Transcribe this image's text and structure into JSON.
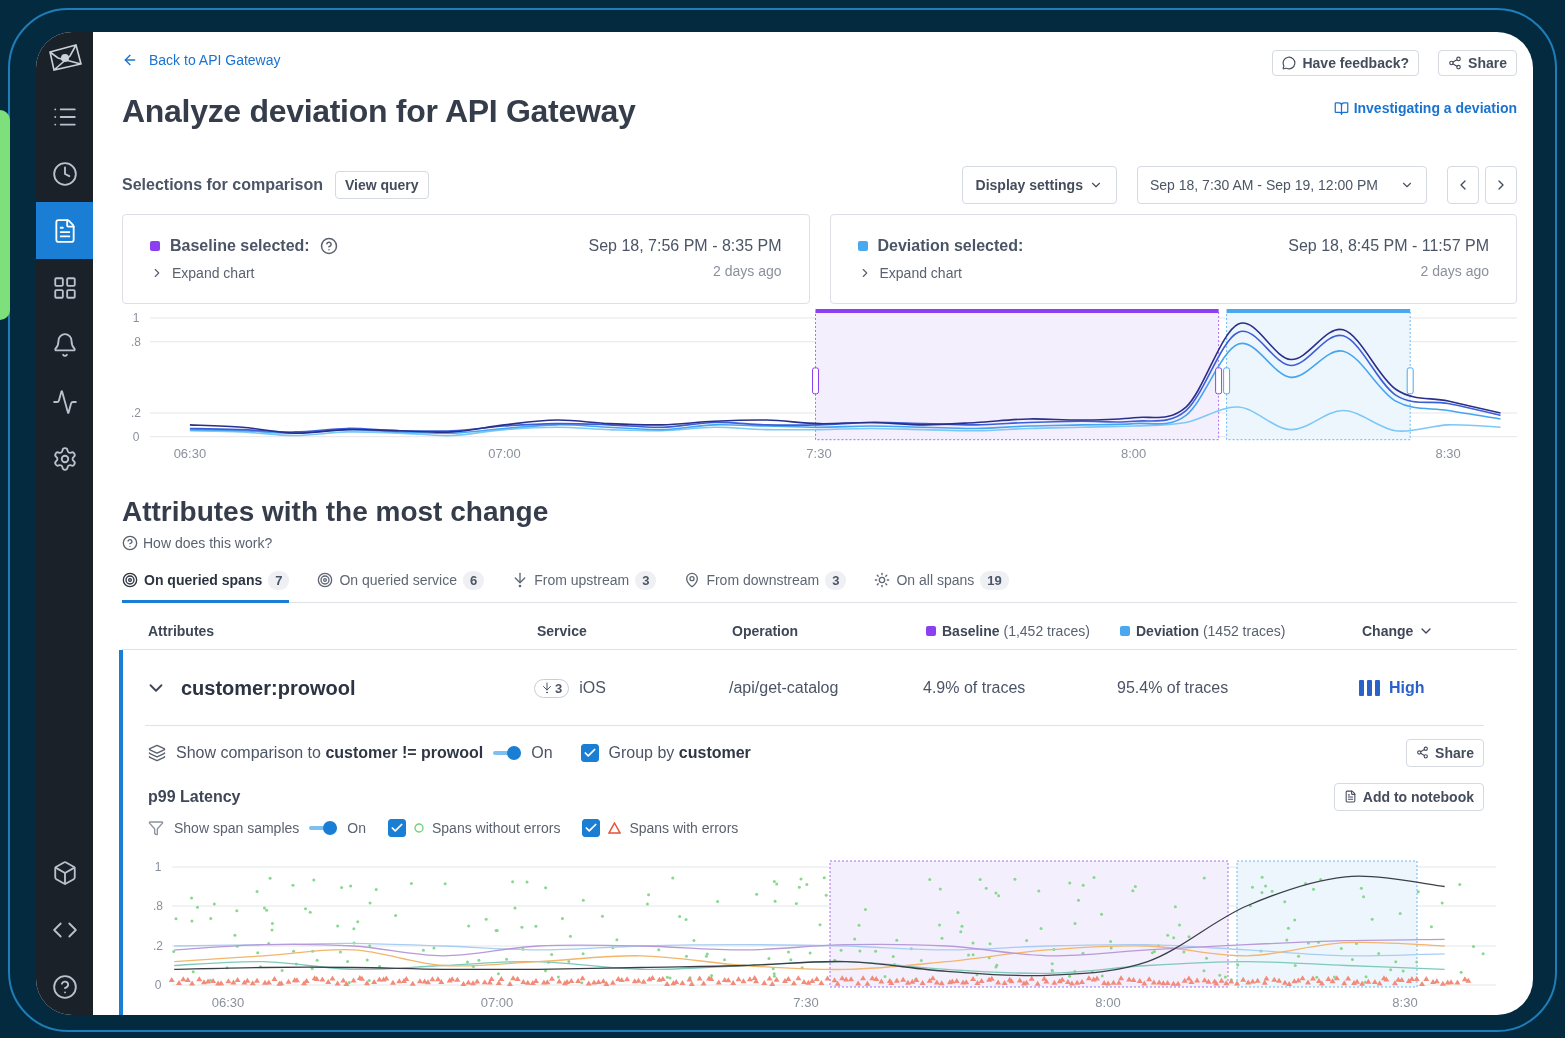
{
  "sidebar": {
    "nav": [
      {
        "selected": false
      },
      {
        "selected": false
      },
      {
        "selected": true
      },
      {
        "selected": false
      },
      {
        "selected": false
      },
      {
        "selected": false
      },
      {
        "selected": false
      }
    ],
    "footer": [
      {
        "selected": false
      },
      {
        "selected": false
      },
      {
        "selected": false
      }
    ]
  },
  "header": {
    "back_link": "Back to API Gateway",
    "title": "Analyze deviation for API Gateway",
    "feedback": "Have feedback?",
    "share": "Share",
    "guide_link": "Investigating a deviation"
  },
  "selections": {
    "label": "Selections for comparison",
    "view_query": "View query",
    "display_settings": "Display settings",
    "range": "Sep 18, 7:30 AM - Sep 19, 12:00 PM"
  },
  "cards": [
    {
      "title": "Baseline selected:",
      "color": "#8b3ff0",
      "help": true,
      "expand": "Expand chart",
      "range": "Sep 18, 7:56 PM - 8:35 PM",
      "ago": "2 days ago"
    },
    {
      "title": "Deviation selected:",
      "color": "#4aa8f0",
      "help": false,
      "expand": "Expand chart",
      "range": "Sep 18, 8:45 PM - 11:57 PM",
      "ago": "2 days ago"
    }
  ],
  "overview_chart": {
    "chart_data": {
      "type": "line",
      "categories": [
        "06:30",
        null,
        null,
        null,
        null,
        null,
        "07:00",
        null,
        null,
        null,
        null,
        null,
        "7:30",
        null,
        null,
        null,
        null,
        null,
        "8:00",
        null,
        null,
        null,
        null,
        null,
        "8:30",
        null
      ],
      "ylim": [
        0,
        1
      ],
      "yticks": [
        {
          "value": 1,
          "label": "1"
        },
        {
          "value": 0.8,
          "label": ".8"
        },
        {
          "value": 0.2,
          "label": ".2"
        },
        {
          "value": 0,
          "label": "0"
        }
      ],
      "series": [
        {
          "color": "#7cc8f7",
          "values": [
            0.05,
            0.04,
            0.01,
            0.04,
            0.03,
            0.01,
            0.06,
            0.08,
            0.06,
            0.05,
            0.08,
            0.06,
            0.06,
            0.07,
            0.06,
            0.05,
            0.07,
            0.08,
            0.09,
            0.12,
            0.25,
            0.06,
            0.22,
            0.05,
            0.1,
            0.08
          ]
        },
        {
          "color": "#45a5f0",
          "values": [
            0.06,
            0.05,
            0.03,
            0.06,
            0.04,
            0.03,
            0.07,
            0.1,
            0.08,
            0.06,
            0.1,
            0.09,
            0.08,
            0.09,
            0.08,
            0.07,
            0.09,
            0.1,
            0.11,
            0.18,
            0.78,
            0.5,
            0.72,
            0.3,
            0.22,
            0.15
          ]
        },
        {
          "color": "#3d5fd6",
          "values": [
            0.07,
            0.06,
            0.04,
            0.07,
            0.05,
            0.05,
            0.09,
            0.11,
            0.1,
            0.08,
            0.12,
            0.1,
            0.1,
            0.12,
            0.11,
            0.1,
            0.12,
            0.13,
            0.13,
            0.22,
            0.88,
            0.6,
            0.85,
            0.35,
            0.28,
            0.18
          ]
        },
        {
          "color": "#2a2f8a",
          "values": [
            0.1,
            0.08,
            0.03,
            0.06,
            0.05,
            0.04,
            0.1,
            0.14,
            0.11,
            0.1,
            0.13,
            0.14,
            0.11,
            0.12,
            0.1,
            0.12,
            0.15,
            0.14,
            0.16,
            0.25,
            0.95,
            0.65,
            0.9,
            0.4,
            0.3,
            0.2
          ]
        }
      ]
    }
  },
  "attributes": {
    "title": "Attributes with the most change",
    "help_link": "How does this work?",
    "tabs": [
      {
        "label": "On queried spans",
        "count": "7",
        "selected": true
      },
      {
        "label": "On queried service",
        "count": "6",
        "selected": false
      },
      {
        "label": "From upstream",
        "count": "3",
        "selected": false
      },
      {
        "label": "From downstream",
        "count": "3",
        "selected": false
      },
      {
        "label": "On all spans",
        "count": "19",
        "selected": false
      }
    ],
    "columns": [
      {
        "label": "Attributes"
      },
      {
        "label": "Service"
      },
      {
        "label": "Operation"
      },
      {
        "label": "**Baseline** (1,452 traces)",
        "color": "#8b3ff0"
      },
      {
        "label": "**Deviation** (1452 traces)",
        "color": "#4aa8f0"
      },
      {
        "label": "Change",
        "sortable": true
      }
    ],
    "row": {
      "expanded": true,
      "attribute": "customer:prowool",
      "service_count": "3",
      "service": "iOS",
      "operation": "/api/get-catalog",
      "baseline": "4.9% of traces",
      "deviation": "95.4% of traces",
      "change": "High"
    }
  },
  "comparison": {
    "text": "Show comparison to **customer != prowool**",
    "on": true,
    "on_label": "On",
    "group_checked": true,
    "group_label": "Group by **customer**",
    "share": "Share"
  },
  "latency": {
    "title": "p99 Latency",
    "add_to_notebook": "Add to notebook",
    "samples_label": "Show span samples",
    "samples_on": true,
    "on_label": "On",
    "filters": [
      {
        "kind": "ok",
        "label": "Spans without errors",
        "checked": true
      },
      {
        "kind": "error",
        "label": "Spans with errors",
        "checked": true
      }
    ],
    "y_ticks": [
      "1",
      ".8",
      ".2",
      "0"
    ],
    "x_ticks": [
      "06:30",
      "07:00",
      "7:30",
      "8:00",
      "8:30"
    ]
  }
}
